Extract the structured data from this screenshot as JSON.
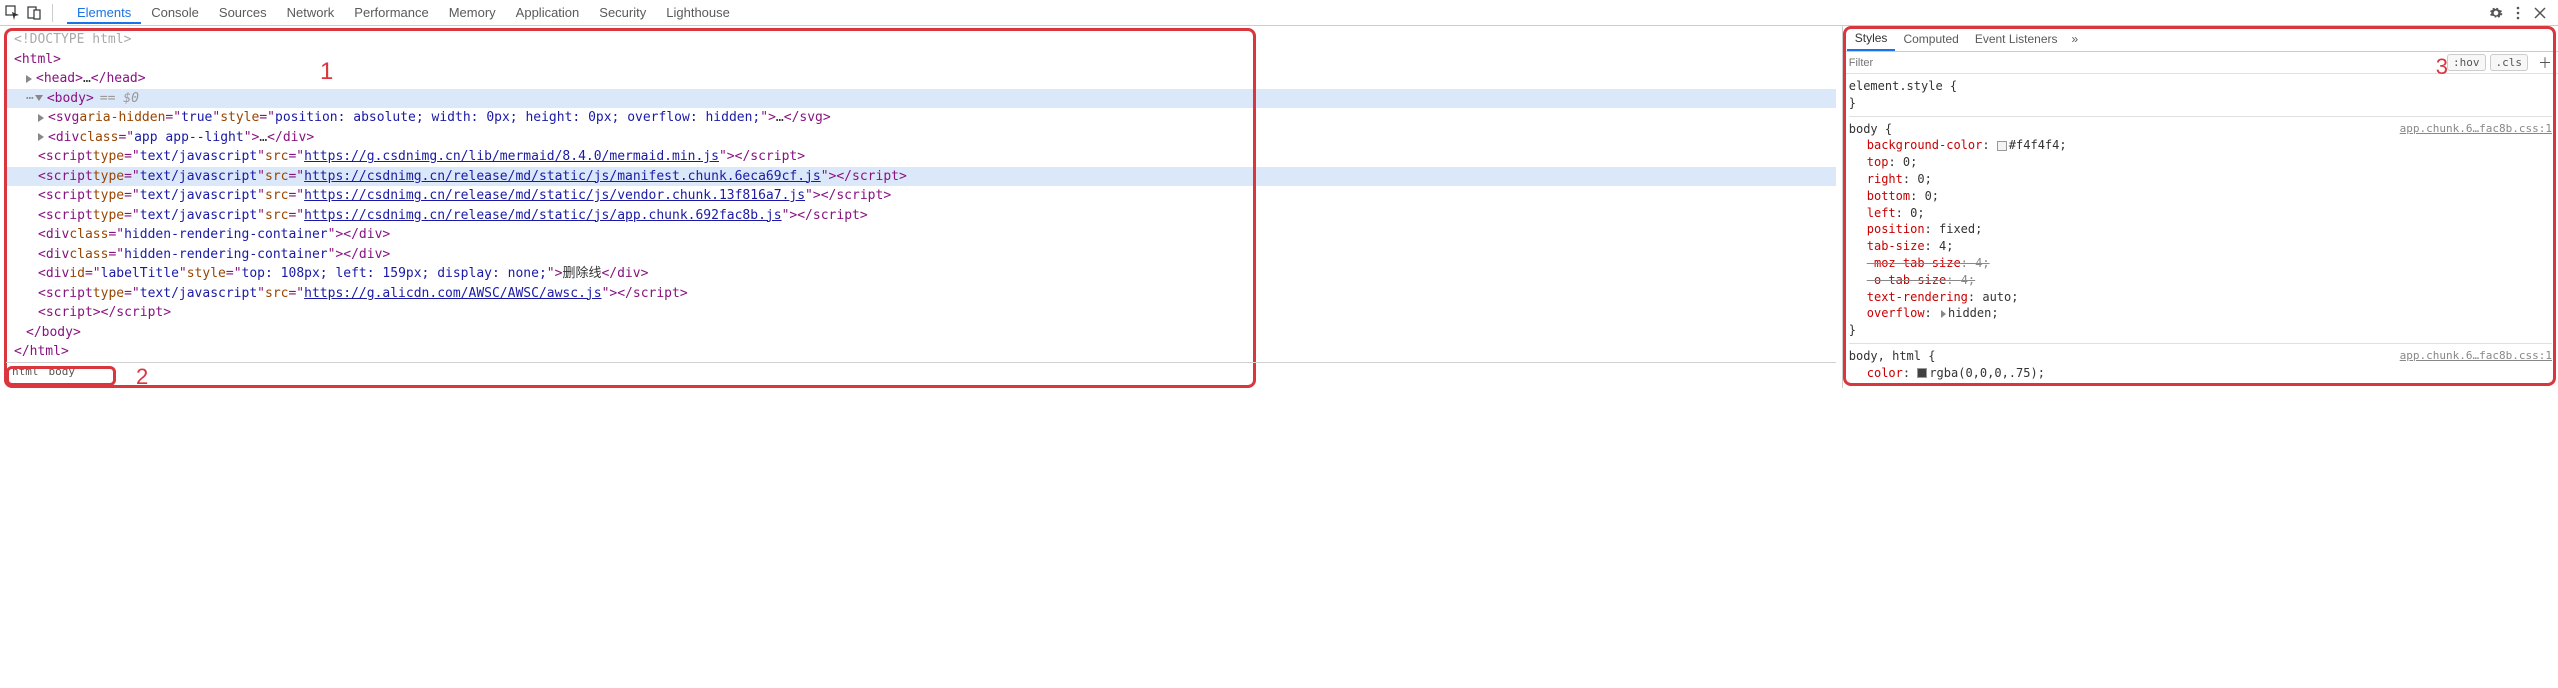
{
  "toolbar": {
    "main_tabs": [
      "Elements",
      "Console",
      "Sources",
      "Network",
      "Performance",
      "Memory",
      "Application",
      "Security",
      "Lighthouse"
    ],
    "active_tab": 0
  },
  "annotations": {
    "n1": "1",
    "n2": "2",
    "n3": "3"
  },
  "dom": {
    "doctype": "<!DOCTYPE html>",
    "html_open": "html",
    "head_tag": "head",
    "head_ell": "…",
    "body_tag": "body",
    "eq0": " == $0",
    "svg": {
      "tag": "svg",
      "aria_attr": "aria-hidden",
      "aria_val": "true",
      "style_attr": "style",
      "style_val": "position: absolute; width: 0px; height: 0px; overflow: hidden;",
      "ell": "…"
    },
    "appdiv": {
      "tag": "div",
      "class_attr": "class",
      "class_val": "app app--light",
      "ell": "…"
    },
    "scripts": [
      {
        "src": "https://g.csdnimg.cn/lib/mermaid/8.4.0/mermaid.min.js",
        "sel": false
      },
      {
        "src": "https://csdnimg.cn/release/md/static/js/manifest.chunk.6eca69cf.js",
        "sel": true
      },
      {
        "src": "https://csdnimg.cn/release/md/static/js/vendor.chunk.13f816a7.js",
        "sel": false
      },
      {
        "src": "https://csdnimg.cn/release/md/static/js/app.chunk.692fac8b.js",
        "sel": false
      }
    ],
    "type_attr": "type",
    "type_val": "text/javascript",
    "src_attr": "src",
    "hidden1": {
      "tag": "div",
      "class_attr": "class",
      "class_val": "hidden-rendering-container"
    },
    "hidden2": {
      "tag": "div",
      "class_attr": "class",
      "class_val": "hidden-rendering-container"
    },
    "label_div": {
      "tag": "div",
      "id_attr": "id",
      "id_val": "labelTitle",
      "style_attr": "style",
      "style_val": "top: 108px; left: 159px; display: none;",
      "text": "删除线"
    },
    "awsc": {
      "src": "https://g.alicdn.com/AWSC/AWSC/awsc.js"
    },
    "empty_script": "script",
    "body_close": "body",
    "html_close": "html"
  },
  "crumbs": [
    "html",
    "body"
  ],
  "styles": {
    "tabs": [
      "Styles",
      "Computed",
      "Event Listeners"
    ],
    "active": 0,
    "filter_placeholder": "Filter",
    "hov": ":hov",
    "cls": ".cls",
    "element_style": "element.style",
    "brace_open": "{",
    "brace_close": "}",
    "rule1": {
      "selector": "body",
      "source": "app.chunk.6…fac8b.css:1",
      "decls": [
        {
          "p": "background-color",
          "v": "#f4f4f4",
          "swatch": "light"
        },
        {
          "p": "top",
          "v": "0"
        },
        {
          "p": "right",
          "v": "0"
        },
        {
          "p": "bottom",
          "v": "0"
        },
        {
          "p": "left",
          "v": "0"
        },
        {
          "p": "position",
          "v": "fixed"
        },
        {
          "p": "tab-size",
          "v": "4"
        },
        {
          "p": "-moz-tab-size",
          "v": "4",
          "strike": true
        },
        {
          "p": "-o-tab-size",
          "v": "4",
          "strike": true
        },
        {
          "p": "text-rendering",
          "v": "auto"
        },
        {
          "p": "overflow",
          "v": "hidden",
          "tri": true
        }
      ]
    },
    "rule2": {
      "selector": "body, html",
      "source": "app.chunk.6…fac8b.css:1",
      "decls": [
        {
          "p": "color",
          "v": "rgba(0,0,0,.75)",
          "swatch": "dark"
        }
      ]
    }
  }
}
